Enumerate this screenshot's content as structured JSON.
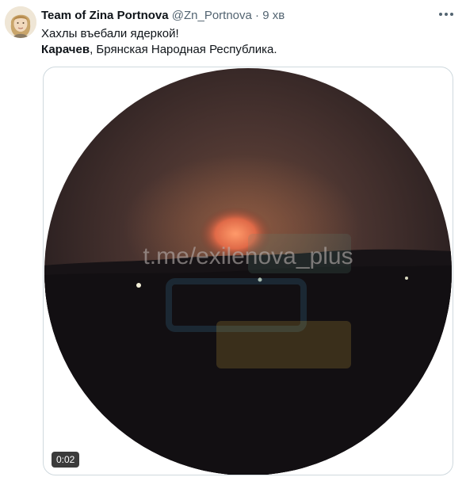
{
  "tweet": {
    "display_name": "Team of Zina Portnova",
    "handle": "@Zn_Portnova",
    "separator": "·",
    "time": "9 хв",
    "text_line1": "Хахлы въебали ядеркой!",
    "text_line2_bold": "Карачев",
    "text_line2_rest": ", Брянская Народная Республика."
  },
  "media": {
    "watermark": "t.me/exilenova_plus",
    "duration": "0:02"
  },
  "icons": {
    "avatar": "avatar",
    "more": "more-icon"
  }
}
